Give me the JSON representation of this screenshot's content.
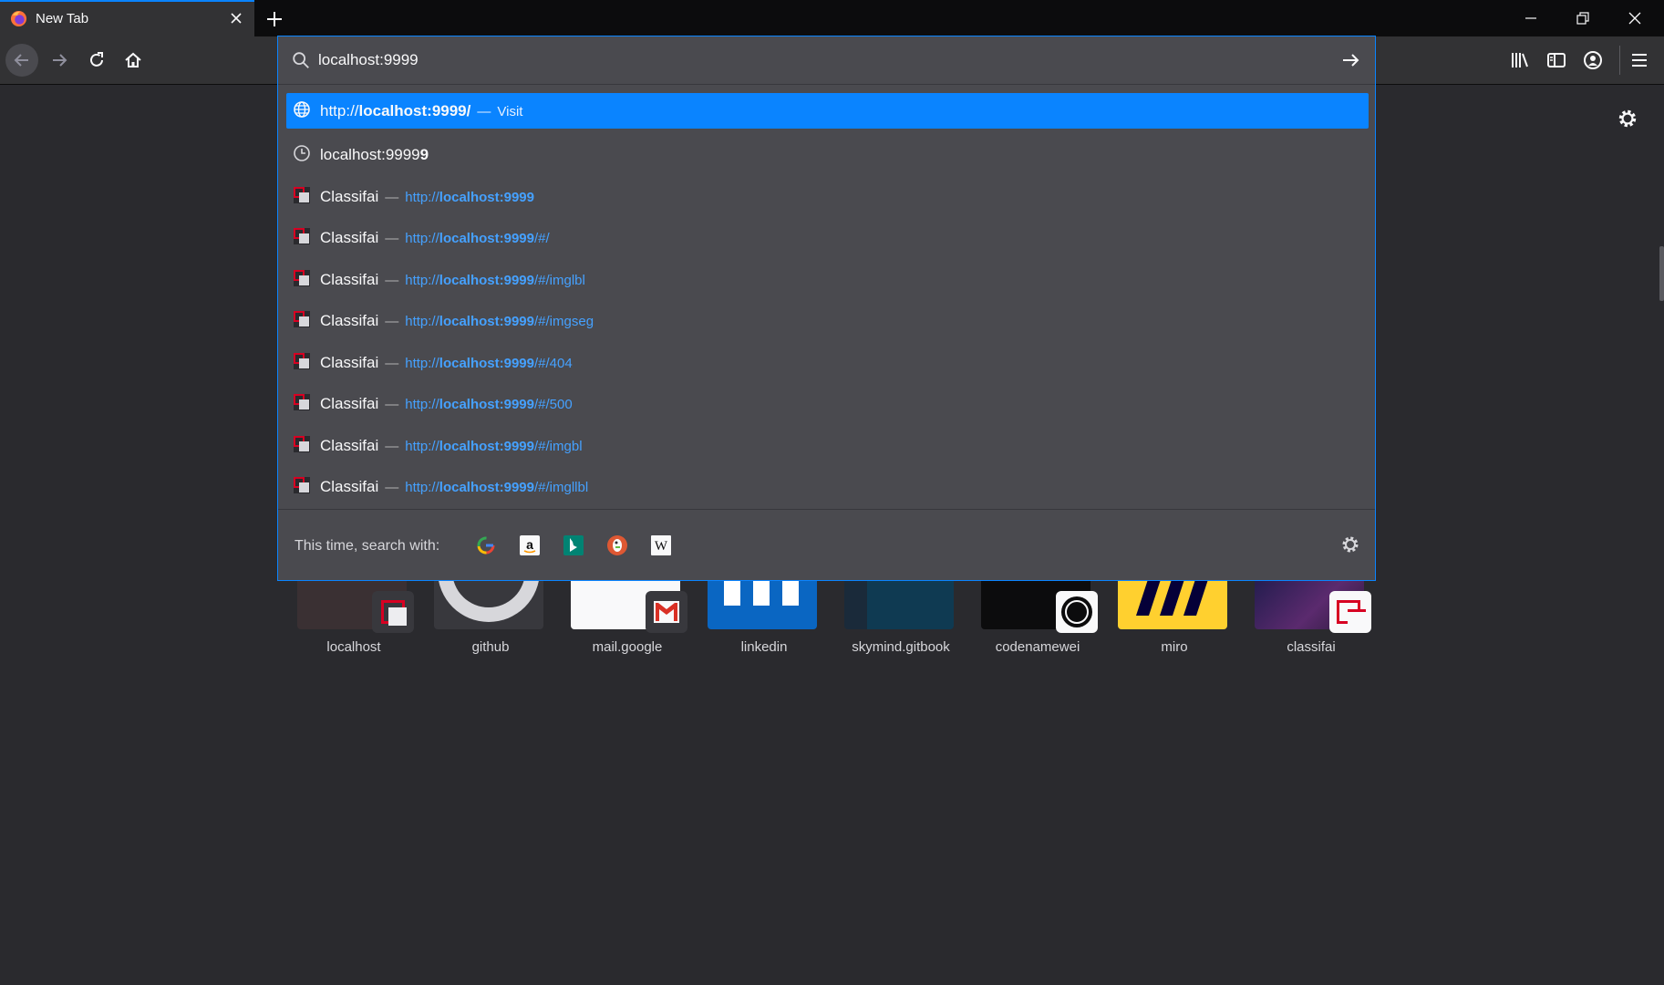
{
  "tab": {
    "title": "New Tab"
  },
  "url_input": {
    "value": "localhost:9999"
  },
  "results": [
    {
      "kind": "visit",
      "icon": "globe-icon",
      "url_prefix": "http://",
      "url_bold": "localhost:9999",
      "url_suffix": "/",
      "separator": "—",
      "action": "Visit"
    },
    {
      "kind": "history",
      "icon": "clock-icon",
      "text_prefix": "localhost:9999",
      "text_bold": "9"
    },
    {
      "kind": "bookmark",
      "icon": "classifai-favicon-icon",
      "title": "Classifai",
      "separator": "—",
      "url_prefix": "http://",
      "url_bold": "localhost:9999",
      "url_suffix": ""
    },
    {
      "kind": "bookmark",
      "icon": "classifai-favicon-icon",
      "title": "Classifai",
      "separator": "—",
      "url_prefix": "http://",
      "url_bold": "localhost:9999",
      "url_suffix": "/#/"
    },
    {
      "kind": "bookmark",
      "icon": "classifai-favicon-icon",
      "title": "Classifai",
      "separator": "—",
      "url_prefix": "http://",
      "url_bold": "localhost:9999",
      "url_suffix": "/#/imglbl"
    },
    {
      "kind": "bookmark",
      "icon": "classifai-favicon-icon",
      "title": "Classifai",
      "separator": "—",
      "url_prefix": "http://",
      "url_bold": "localhost:9999",
      "url_suffix": "/#/imgseg"
    },
    {
      "kind": "bookmark",
      "icon": "classifai-favicon-icon",
      "title": "Classifai",
      "separator": "—",
      "url_prefix": "http://",
      "url_bold": "localhost:9999",
      "url_suffix": "/#/404"
    },
    {
      "kind": "bookmark",
      "icon": "classifai-favicon-icon",
      "title": "Classifai",
      "separator": "—",
      "url_prefix": "http://",
      "url_bold": "localhost:9999",
      "url_suffix": "/#/500"
    },
    {
      "kind": "bookmark",
      "icon": "classifai-favicon-icon",
      "title": "Classifai",
      "separator": "—",
      "url_prefix": "http://",
      "url_bold": "localhost:9999",
      "url_suffix": "/#/imgbl"
    },
    {
      "kind": "bookmark",
      "icon": "classifai-favicon-icon",
      "title": "Classifai",
      "separator": "—",
      "url_prefix": "http://",
      "url_bold": "localhost:9999",
      "url_suffix": "/#/imgllbl"
    }
  ],
  "one_off": {
    "label": "This time, search with:",
    "engines": [
      "google-icon",
      "amazon-icon",
      "bing-icon",
      "duckduckgo-icon",
      "wikipedia-icon"
    ]
  },
  "top_sites": [
    {
      "label": "localhost",
      "badge": "classifai-favicon-icon"
    },
    {
      "label": "github",
      "badge": "github-icon"
    },
    {
      "label": "mail.google",
      "badge": "gmail-icon"
    },
    {
      "label": "linkedin",
      "badge": "linkedin-icon"
    },
    {
      "label": "skymind.gitbook",
      "badge": ""
    },
    {
      "label": "codenamewei",
      "badge": "codenamewei-icon"
    },
    {
      "label": "miro",
      "badge": "miro-icon"
    },
    {
      "label": "classifai",
      "badge": "classifai-favicon-icon"
    }
  ],
  "colors": {
    "accent": "#0a84ff",
    "link": "#45a1ff",
    "background": "#2a2a2e",
    "popup": "#4a4a4f"
  }
}
